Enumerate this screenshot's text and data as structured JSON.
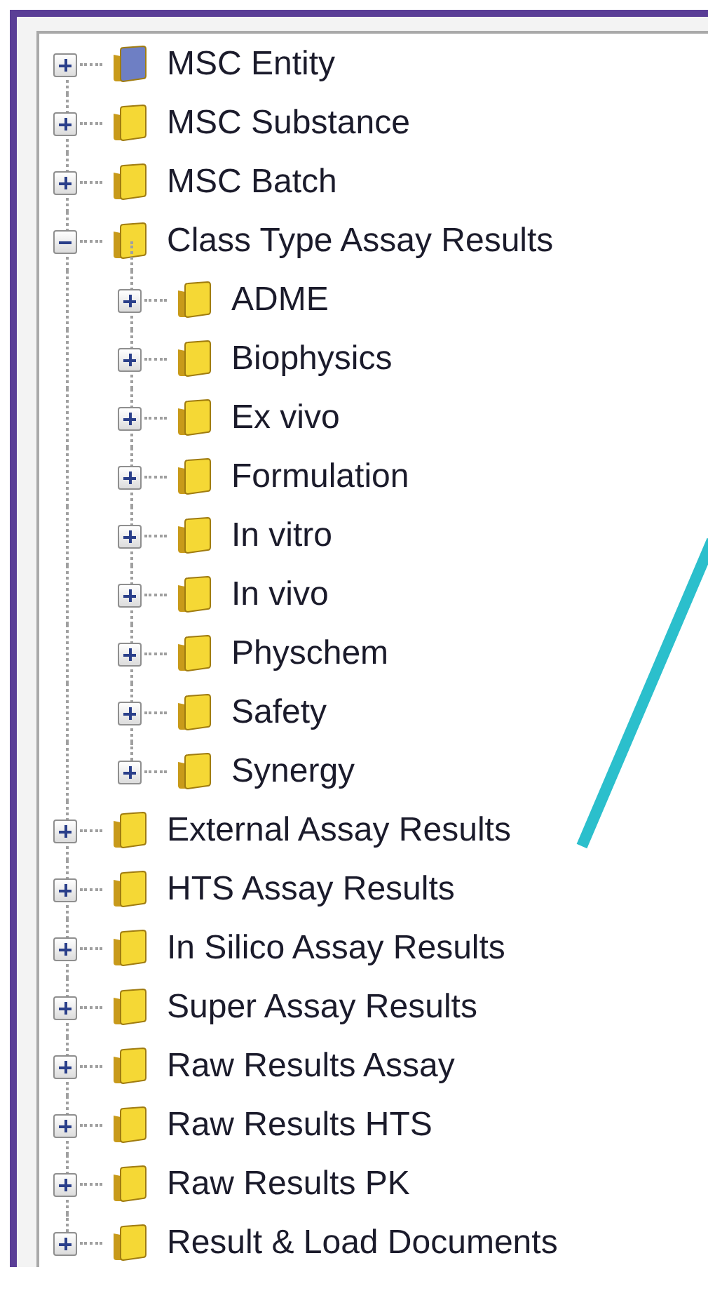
{
  "items": [
    {
      "label": "MSC Entity",
      "expanded": false,
      "color": "#6e7fc4"
    },
    {
      "label": "MSC Substance",
      "expanded": false,
      "color": "#f5d835"
    },
    {
      "label": "MSC Batch",
      "expanded": false,
      "color": "#f5d835"
    },
    {
      "label": "Class Type Assay Results",
      "expanded": true,
      "color": "#f5d835",
      "children": [
        {
          "label": "ADME",
          "expanded": false,
          "color": "#f5d835"
        },
        {
          "label": "Biophysics",
          "expanded": false,
          "color": "#f5d835"
        },
        {
          "label": "Ex vivo",
          "expanded": false,
          "color": "#f5d835"
        },
        {
          "label": "Formulation",
          "expanded": false,
          "color": "#f5d835"
        },
        {
          "label": "In vitro",
          "expanded": false,
          "color": "#f5d835"
        },
        {
          "label": "In vivo",
          "expanded": false,
          "color": "#f5d835"
        },
        {
          "label": "Physchem",
          "expanded": false,
          "color": "#f5d835"
        },
        {
          "label": "Safety",
          "expanded": false,
          "color": "#f5d835"
        },
        {
          "label": "Synergy",
          "expanded": false,
          "color": "#f5d835"
        }
      ]
    },
    {
      "label": "External Assay Results",
      "expanded": false,
      "color": "#f5d835"
    },
    {
      "label": "HTS Assay Results",
      "expanded": false,
      "color": "#f5d835"
    },
    {
      "label": "In Silico Assay Results",
      "expanded": false,
      "color": "#f5d835"
    },
    {
      "label": "Super Assay Results",
      "expanded": false,
      "color": "#f5d835"
    },
    {
      "label": "Raw Results Assay",
      "expanded": false,
      "color": "#f5d835"
    },
    {
      "label": "Raw Results HTS",
      "expanded": false,
      "color": "#f5d835"
    },
    {
      "label": "Raw Results PK",
      "expanded": false,
      "color": "#f5d835"
    },
    {
      "label": "Result & Load Documents",
      "expanded": false,
      "color": "#f5d835"
    }
  ]
}
